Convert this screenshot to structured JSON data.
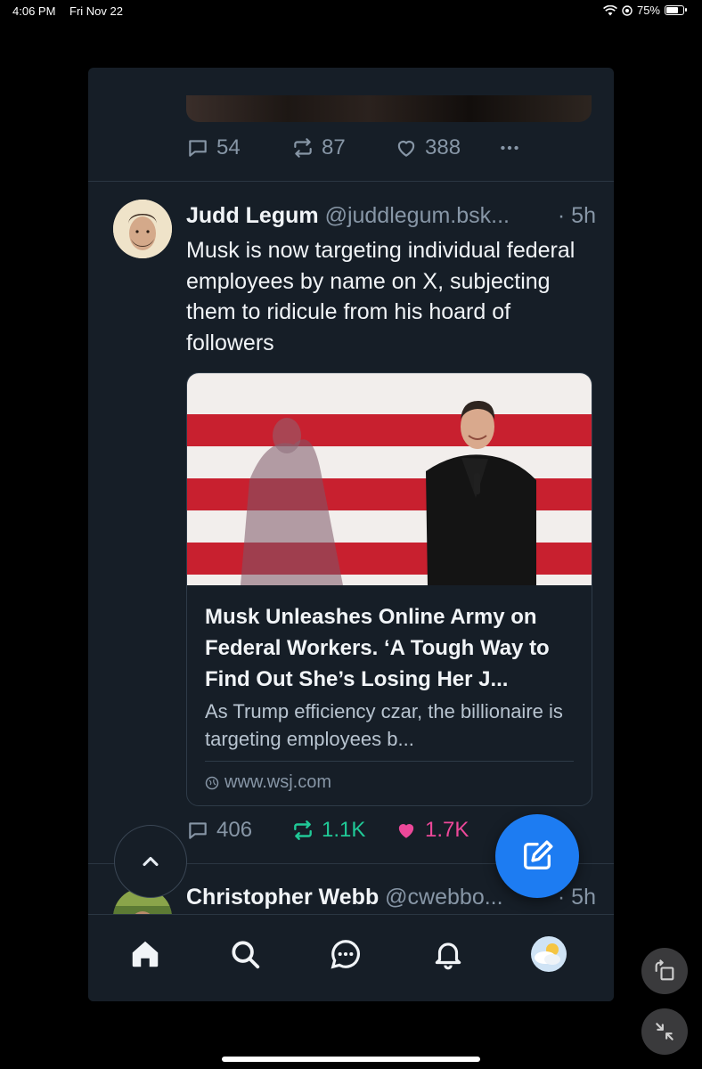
{
  "status_bar": {
    "time": "4:06 PM",
    "date": "Fri Nov 22",
    "battery": "75%",
    "battery_level": 0.75
  },
  "previous_post": {
    "actions": {
      "replies": "54",
      "reposts": "87",
      "likes": "388"
    }
  },
  "post": {
    "author": "Judd Legum",
    "handle": "@juddlegum.bsk...",
    "time": "· 5h",
    "text": "Musk is now targeting individual federal employees by name on X, subjecting them to ridicule from his hoard of followers",
    "card": {
      "title": "Musk Unleashes Online Army on Federal Workers. ‘A Tough Way to Find Out She’s Losing Her J...",
      "description": "As Trump efficiency czar, the billionaire is targeting employees b...",
      "url": "www.wsj.com"
    },
    "actions": {
      "replies": "406",
      "reposts": "1.1K",
      "likes": "1.7K"
    }
  },
  "next_post": {
    "author": "Christopher Webb",
    "handle": "@cwebbo...",
    "time": "· 5h"
  },
  "tab_bar": {
    "items": [
      "home-icon",
      "search-icon",
      "chat-icon",
      "bell-icon",
      "avatar"
    ]
  },
  "colors": {
    "background": "#161e27",
    "accent": "#1d7cf2",
    "repost_active": "#20c997",
    "like_active": "#ec4899",
    "muted": "#8796a6"
  }
}
